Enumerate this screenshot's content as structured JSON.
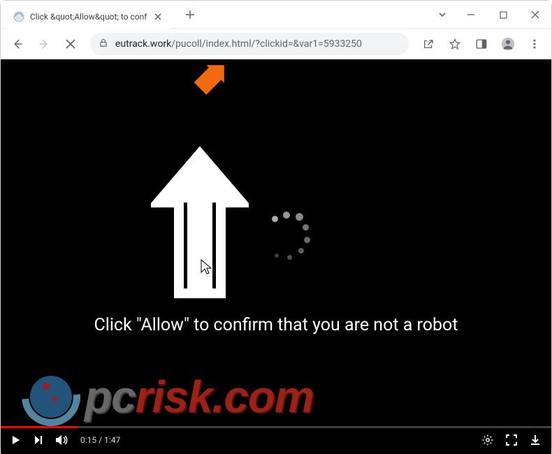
{
  "titlebar": {
    "tab_title": "Click &quot;Allow&quot; to conf",
    "dropdown_chevron": "⌄"
  },
  "toolbar": {
    "url_domain": "eutrack.work",
    "url_path": "/pucoll/index.html/?clickid=&var1=5933250"
  },
  "page": {
    "caption": "Click \"Allow\" to confirm that you are not a robot"
  },
  "video": {
    "current_time": "0:15",
    "separator": " / ",
    "duration": "1:47",
    "progress_pct": 14
  },
  "watermark": {
    "text_gray": "pc",
    "text_red": "risk.com"
  }
}
